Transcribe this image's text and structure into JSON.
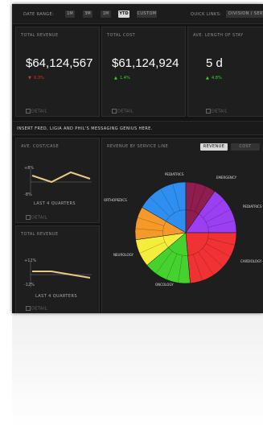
{
  "topbar": {
    "date_range_label": "Date Range:",
    "ranges": [
      "1M",
      "3M",
      "1M",
      "YTD",
      "Custom"
    ],
    "active_range": "YTD",
    "quick_links_label": "Quick Links:",
    "quick_links_value": "Division / Serv"
  },
  "kpis": [
    {
      "title": "Total Revenue",
      "value": "$64,124,567",
      "delta": "0.3%",
      "direction": "down",
      "detail": "Detail"
    },
    {
      "title": "Total Cost",
      "value": "$61,124,924",
      "delta": "1.4%",
      "direction": "up",
      "detail": "Detail"
    },
    {
      "title": "Ave. Length of Stay",
      "value": "5 d",
      "delta": "4.8%",
      "direction": "up",
      "detail": "Detail"
    }
  ],
  "banner": "Insert Fred, Ligia and Phil's messaging genius here.",
  "cost_panel": {
    "title": "Ave. Cost/Case",
    "y_top": "+8%",
    "y_bottom": "-8%",
    "caption": "Last 4 Quarters",
    "detail": "Detail",
    "series": [
      2,
      0,
      3,
      1
    ]
  },
  "rev_panel": {
    "title": "Total Revenue",
    "y_top": "+12%",
    "y_bottom": "-12%",
    "caption": "Last 4 Quarters",
    "detail": "Detail",
    "series": [
      1,
      1,
      0,
      -1
    ]
  },
  "service_panel": {
    "title": "Revenue by Service Line",
    "toggle_revenue": "Revenue",
    "toggle_cost": "Cost",
    "segments": [
      {
        "label": "Pediatrics",
        "color": "#2f8ff0"
      },
      {
        "label": "Emergency",
        "color": "#8f1d4e"
      },
      {
        "label": "Pediatrics",
        "color": "#9b3ff2"
      },
      {
        "label": "Cardiology",
        "color": "#f03232"
      },
      {
        "label": "Oncology",
        "color": "#45d12e"
      },
      {
        "label": "Neurology",
        "color": "#f5ed3c"
      },
      {
        "label": "Orthopedics",
        "color": "#f59a28"
      }
    ]
  },
  "colors": {
    "accent": "#e8c98a",
    "down": "#e03030",
    "up": "#3ccf3c"
  }
}
